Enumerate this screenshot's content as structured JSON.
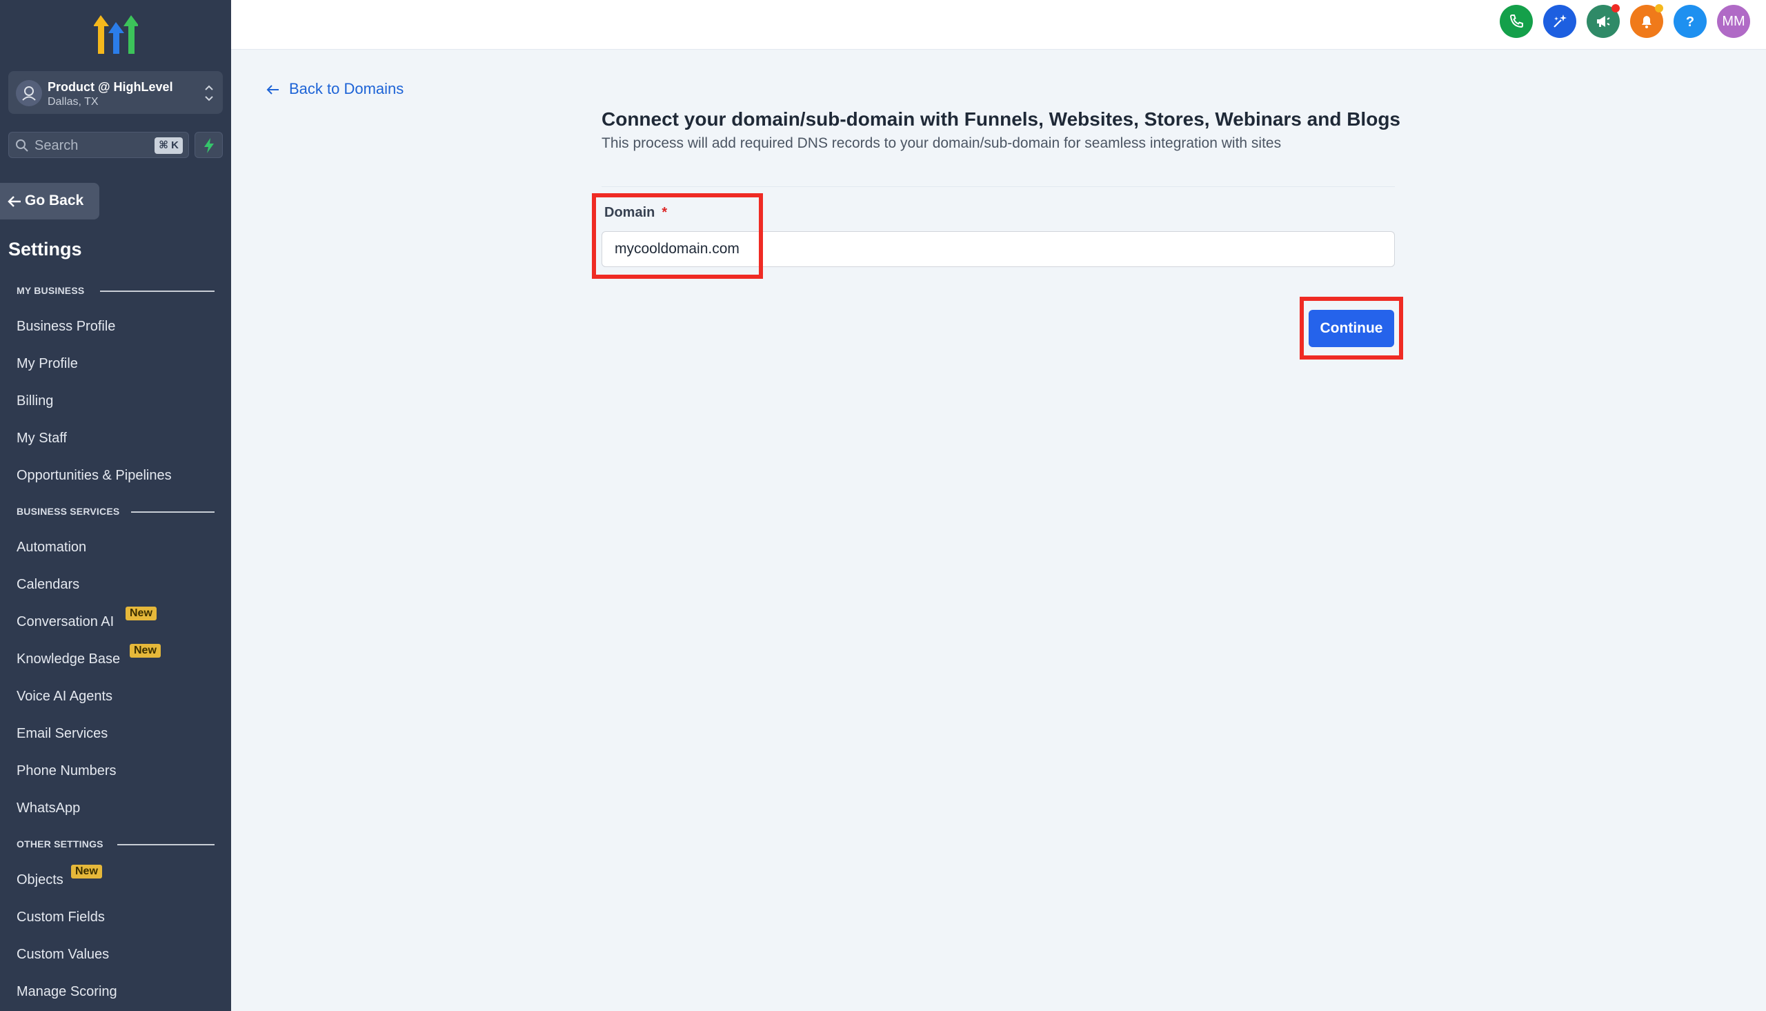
{
  "sidebar": {
    "account": {
      "name": "Product @ HighLevel",
      "location": "Dallas, TX"
    },
    "search": {
      "placeholder": "Search",
      "shortcut": "⌘ K"
    },
    "go_back": "Go Back",
    "title": "Settings",
    "sections": [
      {
        "label": "MY BUSINESS"
      },
      {
        "label": "BUSINESS SERVICES"
      },
      {
        "label": "OTHER SETTINGS"
      }
    ],
    "items": [
      {
        "label": "Business Profile"
      },
      {
        "label": "My Profile"
      },
      {
        "label": "Billing"
      },
      {
        "label": "My Staff"
      },
      {
        "label": "Opportunities & Pipelines"
      },
      {
        "label": "Automation"
      },
      {
        "label": "Calendars"
      },
      {
        "label": "Conversation AI",
        "badge": "New"
      },
      {
        "label": "Knowledge Base",
        "badge": "New"
      },
      {
        "label": "Voice AI Agents"
      },
      {
        "label": "Email Services"
      },
      {
        "label": "Phone Numbers"
      },
      {
        "label": "WhatsApp"
      },
      {
        "label": "Objects",
        "badge": "New"
      },
      {
        "label": "Custom Fields"
      },
      {
        "label": "Custom Values"
      },
      {
        "label": "Manage Scoring"
      }
    ]
  },
  "topbar": {
    "avatar_initials": "MM",
    "icons": [
      "phone-icon",
      "sparkle-icon",
      "megaphone-icon",
      "bell-icon",
      "help-icon"
    ],
    "colors": {
      "phone": "#14a04a",
      "sparkle": "#1d5fe0",
      "megaphone": "#2f8a67",
      "bell": "#f07a1a",
      "help": "#1e90f0",
      "avatar": "#b06ac6"
    }
  },
  "main": {
    "back_link": "Back to Domains",
    "title": "Connect your domain/sub-domain with Funnels, Websites, Stores, Webinars and Blogs",
    "subtitle": "This process will add required DNS records to your domain/sub-domain for seamless integration with sites",
    "domain_label": "Domain",
    "required_mark": "*",
    "domain_value": "mycooldomain.com",
    "continue_label": "Continue",
    "accent_color": "#2563eb",
    "highlight_color": "#ef2b24"
  }
}
